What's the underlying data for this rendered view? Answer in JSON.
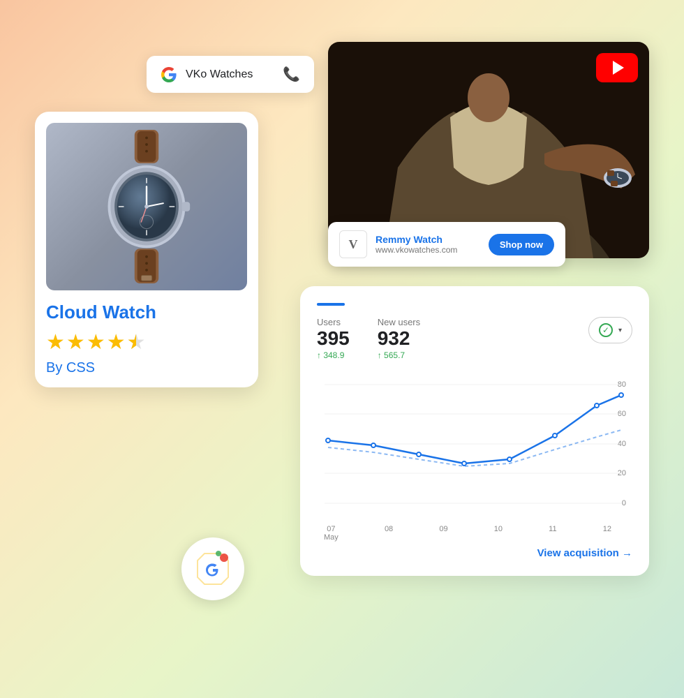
{
  "background": {
    "gradient_start": "#f9c5a0",
    "gradient_end": "#c8e8d8"
  },
  "google_business_card": {
    "brand": "VKo Watches",
    "phone_icon": "📞"
  },
  "product_card": {
    "title": "Cloud Watch",
    "brand": "By CSS",
    "rating": 4.5,
    "stars_display": "★★★★☆"
  },
  "youtube_ad": {
    "ad_brand": "Remmy Watch",
    "ad_url": "www.vkowatches.com",
    "shop_now_label": "Shop now",
    "logo_letter": "V"
  },
  "analytics": {
    "top_bar_color": "#1a73e8",
    "users_label": "Users",
    "users_value": "395",
    "users_change": "↑ 348.9",
    "new_users_label": "New users",
    "new_users_value": "932",
    "new_users_change": "↑ 565.7",
    "view_acquisition_label": "View acquisition →",
    "x_labels": [
      "07\nMay",
      "08",
      "09",
      "10",
      "11",
      "12"
    ],
    "y_labels": [
      "0",
      "20",
      "40",
      "60",
      "80"
    ],
    "solid_line_points": "10,120 70,130 130,150 190,165 250,160 310,135 370,80 430,55",
    "dotted_line_points": "10,130 70,138 130,155 190,170 250,168 310,148 370,110 430,80"
  }
}
